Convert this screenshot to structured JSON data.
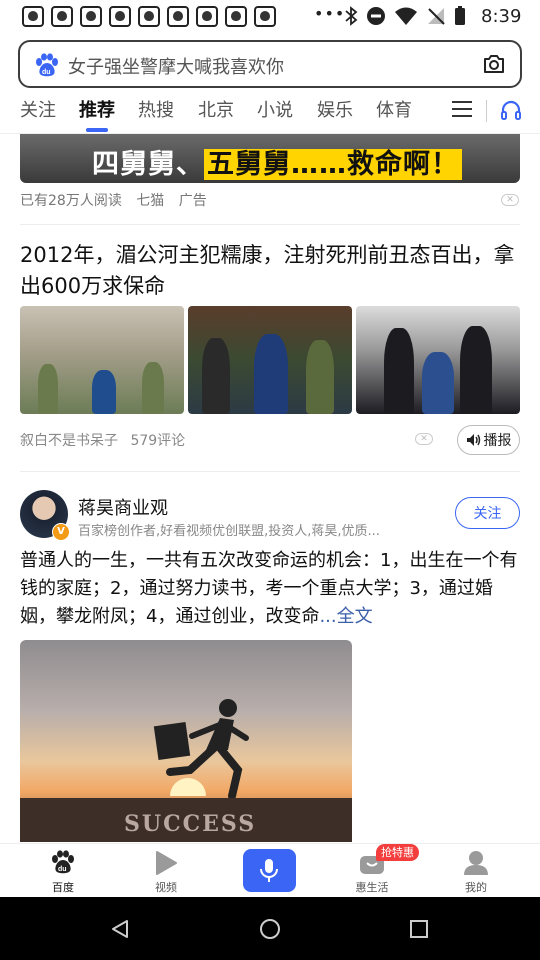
{
  "status_bar": {
    "time": "8:39",
    "more_dots": "•••"
  },
  "search": {
    "placeholder": "女子强坐警摩大喊我喜欢你"
  },
  "tabs": [
    "关注",
    "推荐",
    "热搜",
    "北京",
    "小说",
    "娱乐",
    "体育"
  ],
  "active_tab": "推荐",
  "ad": {
    "banner_text_1": "四舅舅、",
    "banner_text_2": "五舅舅……救命啊！",
    "readers": "已有28万人阅读",
    "source": "七猫",
    "tag": "广告"
  },
  "news": {
    "title": "2012年，湄公河主犯糯康，注射死刑前丑态百出，拿出600万求保命",
    "author": "叙白不是书呆子",
    "comments": "579评论",
    "broadcast_label": "播报"
  },
  "post": {
    "author_name": "蒋昊商业观",
    "author_desc": "百家榜创作者,好看视频优创联盟,投资人,蒋昊,优质...",
    "verified_mark": "V",
    "follow_label": "关注",
    "text": "普通人的一生，一共有五次改变命运的机会：1，出生在一个有钱的家庭；2，通过努力读书，考一个重点大学；3，通过婚姻，攀龙附凤；4，通过创业，改变命",
    "more_label": "...全文",
    "image_caption": "SUCCESS"
  },
  "bottom_nav": {
    "items": [
      "百度",
      "视频",
      "",
      "惠生活",
      "我的"
    ],
    "badge": "抢特惠"
  },
  "colors": {
    "accent": "#3b66f5",
    "badge_red": "#f43e3e",
    "link": "#3b5fa8"
  }
}
